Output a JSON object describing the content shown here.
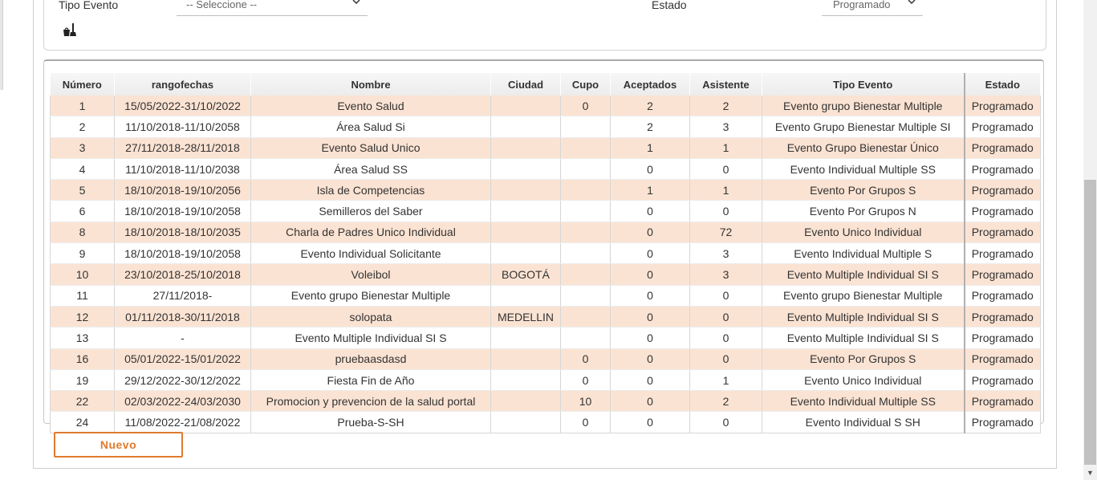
{
  "filters": {
    "tipo_evento_label": "Tipo Evento",
    "tipo_evento_value": "-- Seleccione --",
    "estado_label": "Estado",
    "estado_value": "Programado"
  },
  "icons": {
    "clear_filters": "broom-bucket-icon",
    "dropdown": "chevron-down-icon"
  },
  "table": {
    "columns": [
      "Número",
      "rangofechas",
      "Nombre",
      "Ciudad",
      "Cupo",
      "Aceptados",
      "Asistente",
      "Tipo Evento",
      "Estado"
    ],
    "rows": [
      [
        "1",
        "15/05/2022-31/10/2022",
        "Evento Salud",
        "",
        "0",
        "2",
        "2",
        "Evento grupo Bienestar Multiple",
        "Programado"
      ],
      [
        "2",
        "11/10/2018-11/10/2058",
        "Área Salud Si",
        "",
        "",
        "2",
        "3",
        "Evento Grupo Bienestar Multiple SI",
        "Programado"
      ],
      [
        "3",
        "27/11/2018-28/11/2018",
        "Evento Salud Unico",
        "",
        "",
        "1",
        "1",
        "Evento Grupo Bienestar Único",
        "Programado"
      ],
      [
        "4",
        "11/10/2018-11/10/2038",
        "Área Salud SS",
        "",
        "",
        "0",
        "0",
        "Evento Individual Multiple SS",
        "Programado"
      ],
      [
        "5",
        "18/10/2018-19/10/2056",
        "Isla de Competencias",
        "",
        "",
        "1",
        "1",
        "Evento Por Grupos S",
        "Programado"
      ],
      [
        "6",
        "18/10/2018-19/10/2058",
        "Semilleros del Saber",
        "",
        "",
        "0",
        "0",
        "Evento Por Grupos N",
        "Programado"
      ],
      [
        "8",
        "18/10/2018-18/10/2035",
        "Charla de Padres Unico Individual",
        "",
        "",
        "0",
        "72",
        "Evento Unico Individual",
        "Programado"
      ],
      [
        "9",
        "18/10/2018-19/10/2058",
        "Evento Individual Solicitante",
        "",
        "",
        "0",
        "3",
        "Evento Individual Multiple S",
        "Programado"
      ],
      [
        "10",
        "23/10/2018-25/10/2018",
        "Voleibol",
        "BOGOTÁ",
        "",
        "0",
        "3",
        "Evento Multiple Individual SI S",
        "Programado"
      ],
      [
        "11",
        "27/11/2018-",
        "Evento grupo Bienestar Multiple",
        "",
        "",
        "0",
        "0",
        "Evento grupo Bienestar Multiple",
        "Programado"
      ],
      [
        "12",
        "01/11/2018-30/11/2018",
        "solopata",
        "MEDELLIN",
        "",
        "0",
        "0",
        "Evento Multiple Individual SI S",
        "Programado"
      ],
      [
        "13",
        "-",
        "Evento Multiple Individual SI S",
        "",
        "",
        "0",
        "0",
        "Evento Multiple Individual SI S",
        "Programado"
      ],
      [
        "16",
        "05/01/2022-15/01/2022",
        "pruebaasdasd",
        "",
        "0",
        "0",
        "0",
        "Evento Por Grupos S",
        "Programado"
      ],
      [
        "19",
        "29/12/2022-30/12/2022",
        "Fiesta Fin de Año",
        "",
        "0",
        "0",
        "1",
        "Evento Unico Individual",
        "Programado"
      ],
      [
        "22",
        "02/03/2022-24/03/2030",
        "Promocion y prevencion de la salud portal",
        "",
        "10",
        "0",
        "2",
        "Evento Individual Multiple SS",
        "Programado"
      ],
      [
        "24",
        "11/08/2022-21/08/2022",
        "Prueba-S-SH",
        "",
        "0",
        "0",
        "0",
        "Evento Individual S SH",
        "Programado"
      ]
    ]
  },
  "actions": {
    "nuevo_label": "Nuevo"
  },
  "colors": {
    "accent": "#e07a2e",
    "row_alt": "#fbe3d3"
  }
}
